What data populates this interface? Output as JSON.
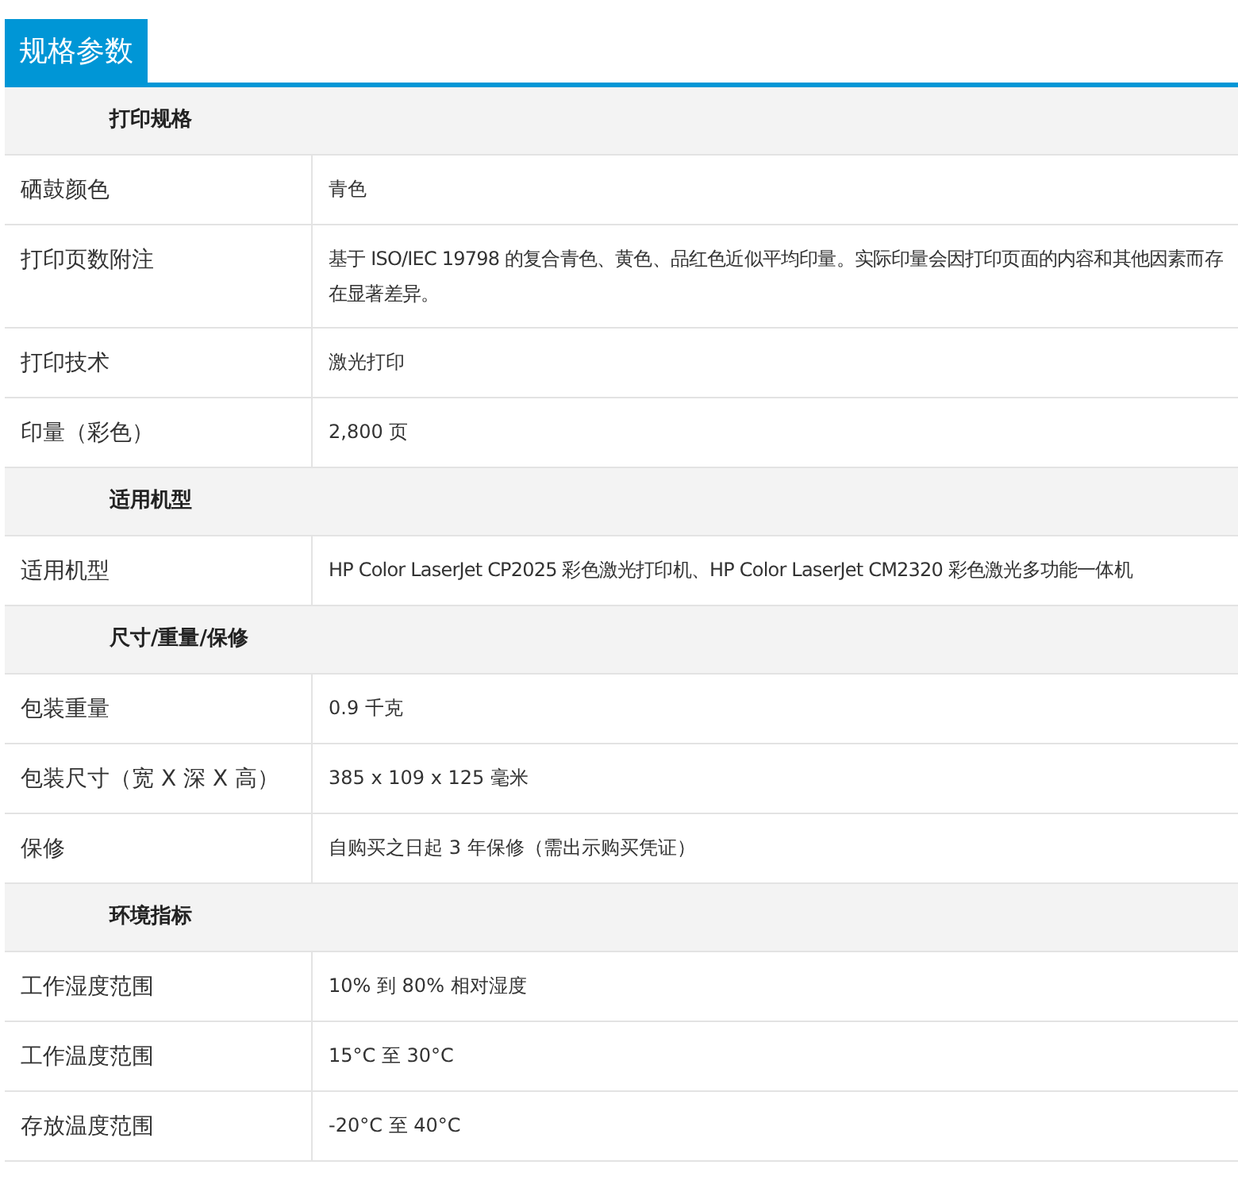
{
  "tab": {
    "label": "规格参数",
    "selected": true
  },
  "sections": [
    {
      "title": "打印规格",
      "rows": [
        {
          "label": "硒鼓颜色",
          "value": "青色"
        },
        {
          "label": "打印页数附注",
          "value": "基于 ISO/IEC 19798 的复合青色、黄色、品红色近似平均印量。实际印量会因打印页面的内容和其他因素而存在显著差异。"
        },
        {
          "label": "打印技术",
          "value": "激光打印"
        },
        {
          "label": "印量（彩色）",
          "value": "2,800 页"
        }
      ]
    },
    {
      "title": "适用机型",
      "rows": [
        {
          "label": "适用机型",
          "value": "HP Color LaserJet CP2025 彩色激光打印机、HP Color LaserJet CM2320 彩色激光多功能一体机"
        }
      ]
    },
    {
      "title": "尺寸/重量/保修",
      "rows": [
        {
          "label": "包装重量",
          "value": "0.9 千克"
        },
        {
          "label": "包装尺寸（宽 X 深 X 高）",
          "value": "385 x 109 x 125 毫米"
        },
        {
          "label": "保修",
          "value": "自购买之日起 3 年保修（需出示购买凭证）"
        }
      ]
    },
    {
      "title": "环境指标",
      "rows": [
        {
          "label": "工作湿度范围",
          "value": "10% 到 80% 相对湿度"
        },
        {
          "label": "工作温度范围",
          "value": "15°C 至 30°C"
        },
        {
          "label": "存放温度范围",
          "value": "-20°C 至 40°C"
        }
      ]
    }
  ]
}
